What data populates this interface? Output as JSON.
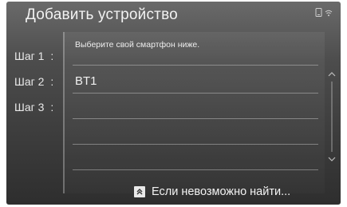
{
  "header": {
    "title": "Добавить устройство",
    "status_icons": [
      "phone-status-icon",
      "wifi-signal-icon"
    ]
  },
  "steps": [
    {
      "label": "Шаг 1",
      "colon": ":"
    },
    {
      "label": "Шаг 2",
      "colon": ":"
    },
    {
      "label": "Шаг 3",
      "colon": ":"
    }
  ],
  "panel": {
    "instruction": "Выберите свой смартфон ниже.",
    "devices": [
      {
        "name": "BT1"
      }
    ]
  },
  "footer": {
    "button_label": "Если невозможно найти...",
    "button_icon": "double-chevron-up-icon"
  },
  "colors": {
    "text": "#f0f0f0",
    "background_top": "#6a6a6a",
    "background_bottom": "#2e2e2e"
  }
}
